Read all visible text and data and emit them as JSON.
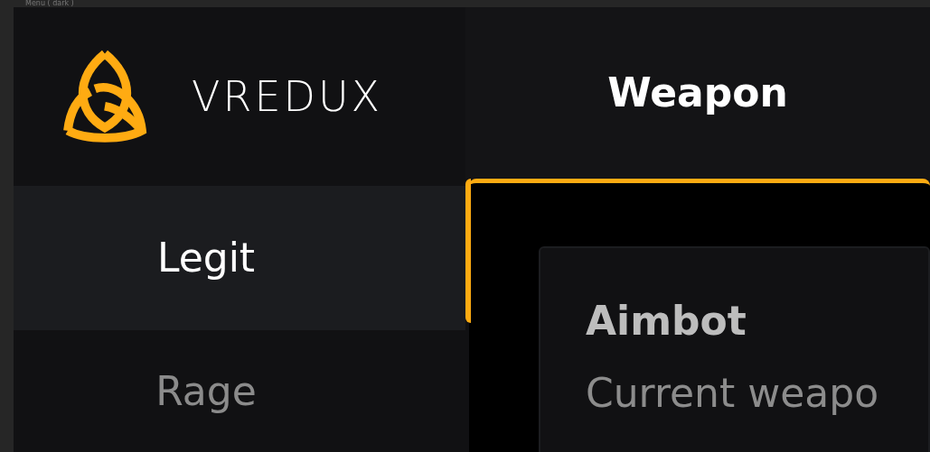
{
  "window": {
    "title": "Menu ( dark )"
  },
  "brand": {
    "name": "VREDUX"
  },
  "sidebar": {
    "items": [
      {
        "label": "Legit",
        "selected": true
      },
      {
        "label": "Rage",
        "selected": false
      }
    ]
  },
  "header": {
    "title": "Weapon"
  },
  "card": {
    "title": "Aimbot",
    "subtitle": "Current weapo"
  }
}
